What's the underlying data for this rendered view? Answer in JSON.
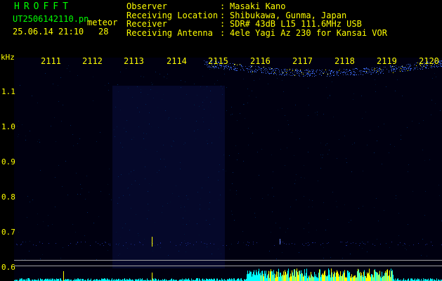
{
  "header": {
    "app_title": "HROFFT",
    "file_name": "UT2506142110.pn",
    "meteor_label": "meteor",
    "datetime": "25.06.14 21:10",
    "meteor_count": "28"
  },
  "station": [
    {
      "label": "Observer",
      "value": "Masaki Kano"
    },
    {
      "label": "Receiving Location",
      "value": "Shibukawa, Gunma, Japan"
    },
    {
      "label": "Receiver",
      "value": "SDR# 43dB L15 111.6MHz USB"
    },
    {
      "label": "Receiving Antenna",
      "value": "4ele Yagi Az 230 for Kansai VOR"
    }
  ],
  "time_ticks": [
    "2111",
    "2112",
    "2113",
    "2114",
    "2115",
    "2116",
    "2117",
    "2118",
    "2119",
    "2120"
  ],
  "freq_axis": {
    "unit": "kHz",
    "ticks": [
      "1.1",
      "1.0",
      "0.9",
      "0.8",
      "0.7",
      "0.6"
    ]
  },
  "colors": {
    "green": "#00ff00",
    "yellow": "#ffff00",
    "cyan": "#00ffff",
    "signal_blue": "#3f6fff",
    "gray_line": "#a0a0a0"
  }
}
